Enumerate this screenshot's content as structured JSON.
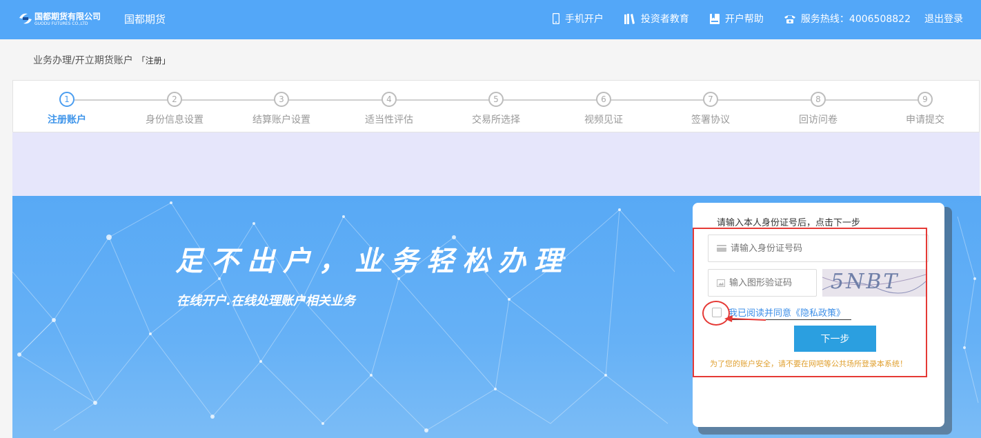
{
  "header": {
    "logo_cn": "国都期货有限公司",
    "logo_en": "GUODU FUTURES CO.,LTD",
    "brand": "国都期货",
    "nav": [
      {
        "icon": "mobile-icon",
        "label": "手机开户"
      },
      {
        "icon": "books-icon",
        "label": "投资者教育"
      },
      {
        "icon": "bookmark-icon",
        "label": "开户帮助"
      },
      {
        "icon": "phone-icon",
        "label": "服务热线：4006508822"
      }
    ],
    "logout": "退出登录"
  },
  "breadcrumb": {
    "path": "业务办理/开立期货账户",
    "tag": "「注册」"
  },
  "steps": [
    {
      "num": "1",
      "label": "注册账户",
      "active": true
    },
    {
      "num": "2",
      "label": "身份信息设置",
      "active": false
    },
    {
      "num": "3",
      "label": "结算账户设置",
      "active": false
    },
    {
      "num": "4",
      "label": "适当性评估",
      "active": false
    },
    {
      "num": "5",
      "label": "交易所选择",
      "active": false
    },
    {
      "num": "6",
      "label": "视频见证",
      "active": false
    },
    {
      "num": "7",
      "label": "签署协议",
      "active": false
    },
    {
      "num": "8",
      "label": "回访问卷",
      "active": false
    },
    {
      "num": "9",
      "label": "申请提交",
      "active": false
    }
  ],
  "hero": {
    "title": "足不出户，业务轻松办理",
    "subtitle": "在线开户.在线处理账户相关业务"
  },
  "login": {
    "hint": "请输入本人身份证号后，点击下一步",
    "id_placeholder": "请输入身份证号码",
    "captcha_placeholder": "输入图形验证码",
    "captcha_text": "5NBT",
    "agree_text": "我已阅读并同意《隐私政策》",
    "next": "下一步",
    "warning": "为了您的账户安全，请不要在网吧等公共场所登录本系统！"
  },
  "colors": {
    "header_bg": "#53a7f8",
    "accent": "#3f95ea",
    "button": "#2b9fe0",
    "annotation_red": "#e53935",
    "warning": "#e0a030"
  }
}
